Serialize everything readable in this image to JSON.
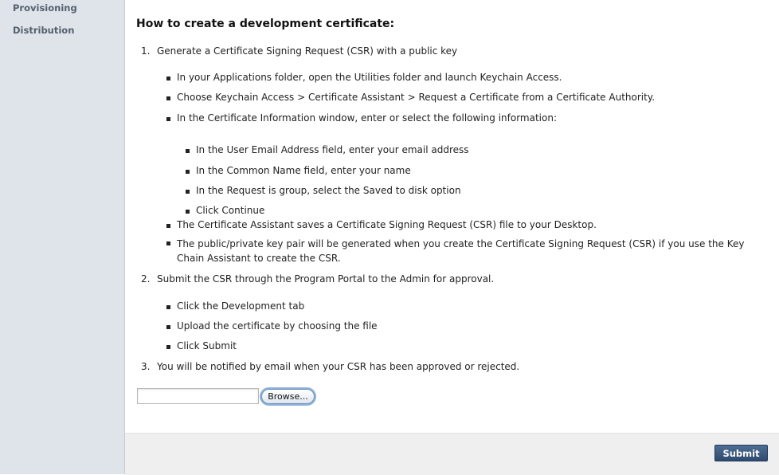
{
  "sidebar": {
    "items": [
      {
        "label": "Provisioning"
      },
      {
        "label": "Distribution"
      }
    ]
  },
  "main": {
    "heading": "How to create a development certificate:",
    "steps": [
      {
        "number": "1.",
        "text": "Generate a Certificate Signing Request (CSR) with a public key",
        "bullets": [
          "In your Applications folder, open the Utilities folder and launch Keychain Access.",
          "Choose Keychain Access > Certificate Assistant > Request a Certificate from a Certificate Authority.",
          "In the Certificate Information window, enter or select the following information:"
        ],
        "sub_bullets": [
          "In the User Email Address field, enter your email address",
          "In the Common Name field, enter your name",
          "In the Request is group, select the Saved to disk option",
          "Click Continue"
        ],
        "after_bullets": [
          "The Certificate Assistant saves a Certificate Signing Request (CSR) file to your Desktop.",
          "The public/private key pair will be generated when you create the Certificate Signing Request (CSR) if you use the Key Chain Assistant to create the CSR."
        ]
      },
      {
        "number": "2.",
        "text": "Submit the CSR through the Program Portal to the Admin for approval.",
        "bullets": [
          "Click the Development tab",
          "Upload the certificate by choosing the file",
          "Click Submit"
        ]
      },
      {
        "number": "3.",
        "text": "You will be notified by email when your CSR has been approved or rejected."
      }
    ],
    "file_input": {
      "value": "",
      "browse_label": "Browse..."
    },
    "submit_label": "Submit"
  }
}
